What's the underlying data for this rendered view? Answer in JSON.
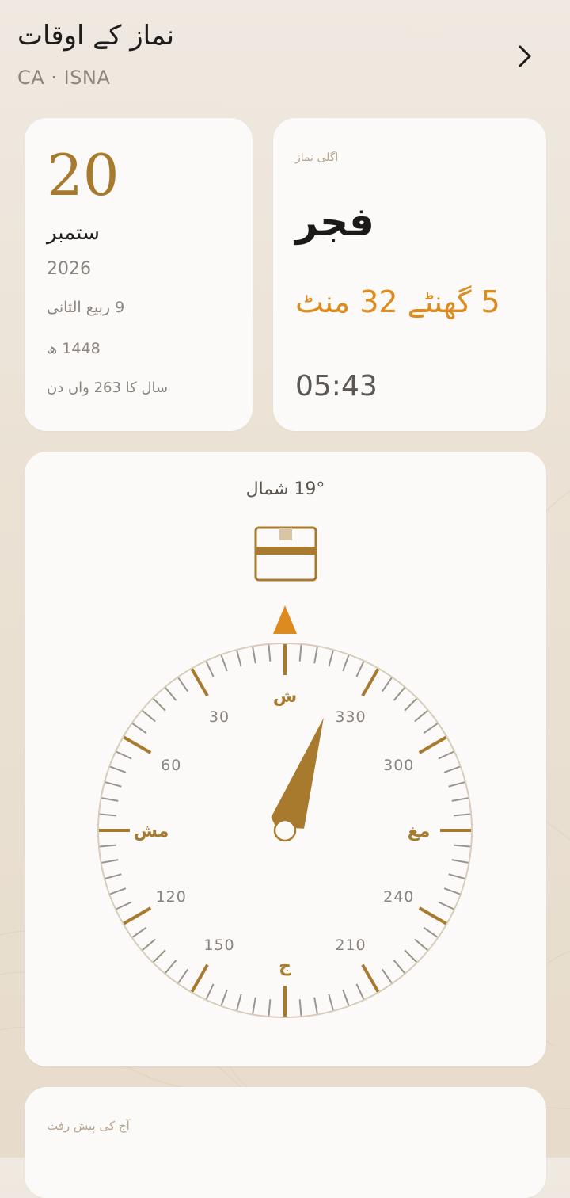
{
  "header": {
    "title": "نماز کے اوقات",
    "subtitle": "CA · ISNA",
    "next_icon": "chevron-right-icon"
  },
  "date_card": {
    "day": "20",
    "month": "ستمبر",
    "year": "2026",
    "hijri_date": "9 ربیع الثانی",
    "hijri_year": "1448 ھ",
    "day_of_year": "سال کا 263 واں دن"
  },
  "next_prayer": {
    "label": "اگلی نماز",
    "name": "فجر",
    "remaining": "5 گھنٹے 32 منٹ",
    "time": "05:43"
  },
  "qibla": {
    "heading_text": "19° شمال",
    "kaaba_icon": "kaaba-icon",
    "needle_degrees": 19,
    "cardinals": {
      "north": "ش",
      "east": "مش",
      "south": "ج",
      "west": "مغ"
    },
    "degree_labels": [
      "30",
      "60",
      "120",
      "150",
      "210",
      "240",
      "300",
      "330"
    ]
  },
  "progress": {
    "label": "آج کی پیش رفت"
  },
  "colors": {
    "accent": "#a87a2e",
    "highlight": "#dc8b1f",
    "card": "#fcfaf8",
    "background": "#ebe2d5"
  }
}
